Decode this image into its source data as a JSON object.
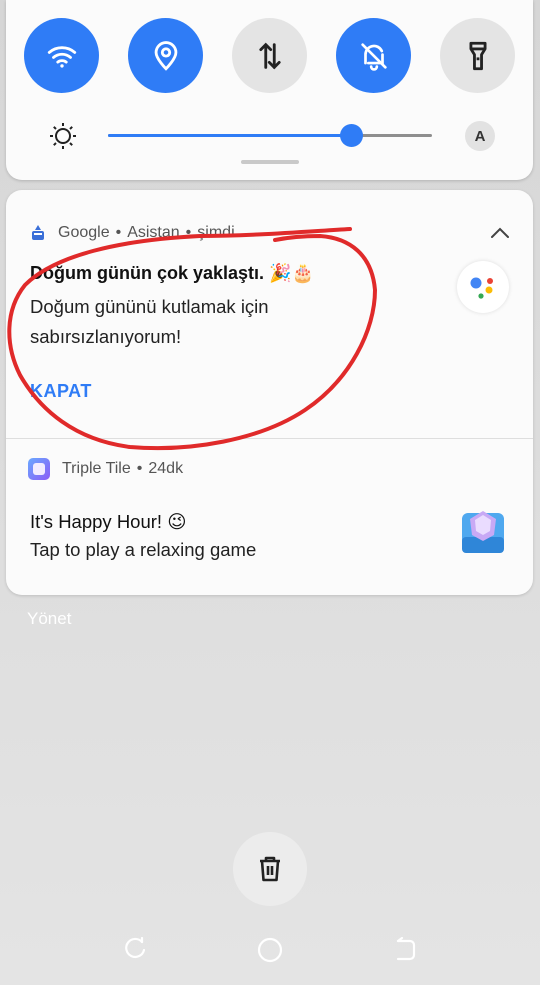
{
  "quick_settings": {
    "tiles": [
      {
        "name": "wifi",
        "icon": "wifi-icon",
        "state": "on"
      },
      {
        "name": "location",
        "icon": "location-icon",
        "state": "on"
      },
      {
        "name": "mobile-data",
        "icon": "data-arrows-icon",
        "state": "off"
      },
      {
        "name": "do-not-disturb",
        "icon": "bell-off-icon",
        "state": "on"
      },
      {
        "name": "flashlight",
        "icon": "flashlight-icon",
        "state": "off"
      }
    ],
    "brightness_level": 0.75,
    "auto_brightness_label": "A"
  },
  "notifications": [
    {
      "app": "Google",
      "sub": "Asistan",
      "time": "şimdi",
      "title": "Doğum günün çok yaklaştı. 🎉🎂",
      "body": "Doğum gününü kutlamak için sabırsızlanıyorum!",
      "action": "KAPAT"
    },
    {
      "app": "Triple Tile",
      "time": "24dk",
      "title": "It's Happy Hour! 😉",
      "body": "Tap to play a relaxing game"
    }
  ],
  "manage_label": "Yönet",
  "colors": {
    "accent": "#2f7cf6",
    "annotation": "#e02a2a"
  }
}
